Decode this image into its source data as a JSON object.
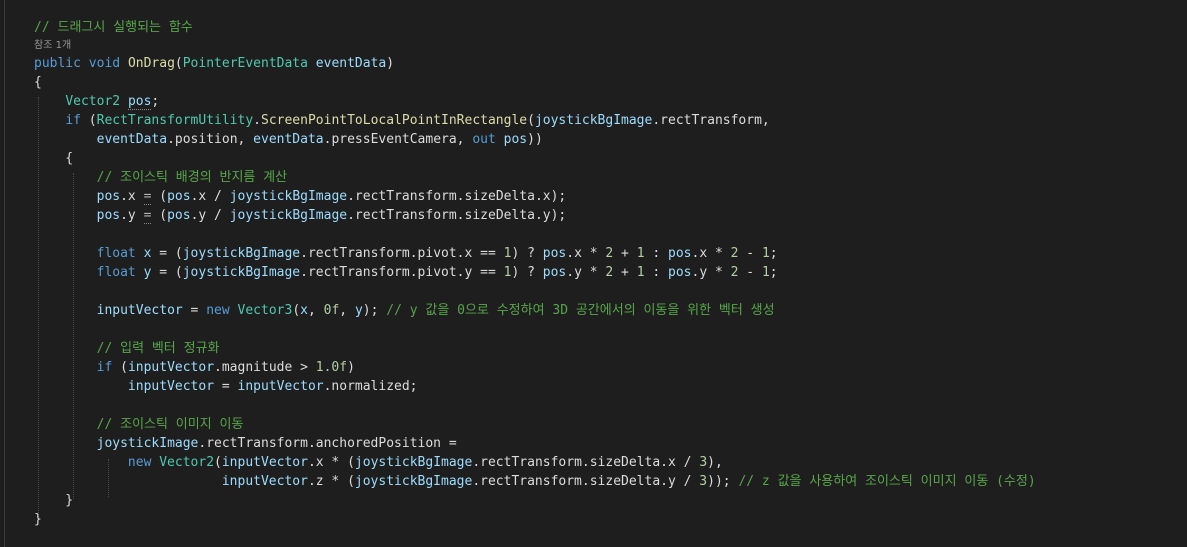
{
  "code_lens": "참조 1개",
  "lines": [
    {
      "t": [
        [
          "cmt",
          "// 드래그시 실행되는 함수"
        ]
      ]
    },
    {
      "t": [
        [
          "kw",
          "public"
        ],
        [
          "pl",
          " "
        ],
        [
          "kw",
          "void"
        ],
        [
          "pl",
          " "
        ],
        [
          "fn",
          "OnDrag"
        ],
        [
          "pl",
          "("
        ],
        [
          "ty",
          "PointerEventData"
        ],
        [
          "pl",
          " "
        ],
        [
          "var",
          "eventData"
        ],
        [
          "pl",
          ")"
        ]
      ]
    },
    {
      "t": [
        [
          "pl",
          "{"
        ]
      ]
    },
    {
      "t": [
        [
          "pl",
          "    "
        ],
        [
          "ty",
          "Vector2"
        ],
        [
          "pl",
          " "
        ],
        [
          "var",
          "pos"
        ],
        [
          "pl",
          ";"
        ]
      ]
    },
    {
      "t": [
        [
          "pl",
          "    "
        ],
        [
          "kw",
          "if"
        ],
        [
          "pl",
          " ("
        ],
        [
          "ty",
          "RectTransformUtility"
        ],
        [
          "pl",
          "."
        ],
        [
          "fn",
          "ScreenPointToLocalPointInRectangle"
        ],
        [
          "pl",
          "("
        ],
        [
          "var",
          "joystickBgImage"
        ],
        [
          "pl",
          ".rectTransform,"
        ]
      ]
    },
    {
      "t": [
        [
          "pl",
          "        "
        ],
        [
          "var",
          "eventData"
        ],
        [
          "pl",
          ".position, "
        ],
        [
          "var",
          "eventData"
        ],
        [
          "pl",
          ".pressEventCamera, "
        ],
        [
          "kw",
          "out"
        ],
        [
          "pl",
          " "
        ],
        [
          "var",
          "pos"
        ],
        [
          "pl",
          "))"
        ]
      ]
    },
    {
      "t": [
        [
          "pl",
          "    {"
        ]
      ]
    },
    {
      "t": [
        [
          "pl",
          "        "
        ],
        [
          "cmt",
          "// 조이스틱 배경의 반지름 계산"
        ]
      ]
    },
    {
      "t": [
        [
          "pl",
          "        "
        ],
        [
          "var",
          "pos"
        ],
        [
          "pl",
          ".x "
        ],
        [
          "op",
          "="
        ],
        [
          "pl",
          " ("
        ],
        [
          "var",
          "pos"
        ],
        [
          "pl",
          ".x / "
        ],
        [
          "var",
          "joystickBgImage"
        ],
        [
          "pl",
          ".rectTransform.sizeDelta.x);"
        ]
      ]
    },
    {
      "t": [
        [
          "pl",
          "        "
        ],
        [
          "var",
          "pos"
        ],
        [
          "pl",
          ".y "
        ],
        [
          "op",
          "="
        ],
        [
          "pl",
          " ("
        ],
        [
          "var",
          "pos"
        ],
        [
          "pl",
          ".y / "
        ],
        [
          "var",
          "joystickBgImage"
        ],
        [
          "pl",
          ".rectTransform.sizeDelta.y);"
        ]
      ]
    },
    {
      "t": [
        [
          "pl",
          ""
        ]
      ]
    },
    {
      "t": [
        [
          "pl",
          "        "
        ],
        [
          "kw",
          "float"
        ],
        [
          "pl",
          " "
        ],
        [
          "var",
          "x"
        ],
        [
          "pl",
          " = ("
        ],
        [
          "var",
          "joystickBgImage"
        ],
        [
          "pl",
          ".rectTransform.pivot.x == "
        ],
        [
          "num",
          "1"
        ],
        [
          "pl",
          ") ? "
        ],
        [
          "var",
          "pos"
        ],
        [
          "pl",
          ".x * "
        ],
        [
          "num",
          "2"
        ],
        [
          "pl",
          " + "
        ],
        [
          "num",
          "1"
        ],
        [
          "pl",
          " : "
        ],
        [
          "var",
          "pos"
        ],
        [
          "pl",
          ".x * "
        ],
        [
          "num",
          "2"
        ],
        [
          "pl",
          " - "
        ],
        [
          "num",
          "1"
        ],
        [
          "pl",
          ";"
        ]
      ]
    },
    {
      "t": [
        [
          "pl",
          "        "
        ],
        [
          "kw",
          "float"
        ],
        [
          "pl",
          " "
        ],
        [
          "var",
          "y"
        ],
        [
          "pl",
          " = ("
        ],
        [
          "var",
          "joystickBgImage"
        ],
        [
          "pl",
          ".rectTransform.pivot.y == "
        ],
        [
          "num",
          "1"
        ],
        [
          "pl",
          ") ? "
        ],
        [
          "var",
          "pos"
        ],
        [
          "pl",
          ".y * "
        ],
        [
          "num",
          "2"
        ],
        [
          "pl",
          " + "
        ],
        [
          "num",
          "1"
        ],
        [
          "pl",
          " : "
        ],
        [
          "var",
          "pos"
        ],
        [
          "pl",
          ".y * "
        ],
        [
          "num",
          "2"
        ],
        [
          "pl",
          " - "
        ],
        [
          "num",
          "1"
        ],
        [
          "pl",
          ";"
        ]
      ]
    },
    {
      "t": [
        [
          "pl",
          ""
        ]
      ]
    },
    {
      "t": [
        [
          "pl",
          "        "
        ],
        [
          "var",
          "inputVector"
        ],
        [
          "pl",
          " = "
        ],
        [
          "kw",
          "new"
        ],
        [
          "pl",
          " "
        ],
        [
          "ty",
          "Vector3"
        ],
        [
          "pl",
          "("
        ],
        [
          "var",
          "x"
        ],
        [
          "pl",
          ", "
        ],
        [
          "num",
          "0f"
        ],
        [
          "pl",
          ", "
        ],
        [
          "var",
          "y"
        ],
        [
          "pl",
          "); "
        ],
        [
          "cmt",
          "// y 값을 0으로 수정하여 3D 공간에서의 이동을 위한 벡터 생성"
        ]
      ]
    },
    {
      "t": [
        [
          "pl",
          ""
        ]
      ]
    },
    {
      "t": [
        [
          "pl",
          "        "
        ],
        [
          "cmt",
          "// 입력 벡터 정규화"
        ]
      ]
    },
    {
      "t": [
        [
          "pl",
          "        "
        ],
        [
          "kw",
          "if"
        ],
        [
          "pl",
          " ("
        ],
        [
          "var",
          "inputVector"
        ],
        [
          "pl",
          ".magnitude > "
        ],
        [
          "num",
          "1.0f"
        ],
        [
          "pl",
          ")"
        ]
      ]
    },
    {
      "t": [
        [
          "pl",
          "            "
        ],
        [
          "var",
          "inputVector"
        ],
        [
          "pl",
          " = "
        ],
        [
          "var",
          "inputVector"
        ],
        [
          "pl",
          ".normalized;"
        ]
      ]
    },
    {
      "t": [
        [
          "pl",
          ""
        ]
      ]
    },
    {
      "t": [
        [
          "pl",
          "        "
        ],
        [
          "cmt",
          "// 조이스틱 이미지 이동"
        ]
      ]
    },
    {
      "t": [
        [
          "pl",
          "        "
        ],
        [
          "var",
          "joystickImage"
        ],
        [
          "pl",
          ".rectTransform.anchoredPosition ="
        ]
      ]
    },
    {
      "t": [
        [
          "pl",
          "            "
        ],
        [
          "kw",
          "new"
        ],
        [
          "pl",
          " "
        ],
        [
          "ty",
          "Vector2"
        ],
        [
          "pl",
          "("
        ],
        [
          "var",
          "inputVector"
        ],
        [
          "pl",
          ".x * ("
        ],
        [
          "var",
          "joystickBgImage"
        ],
        [
          "pl",
          ".rectTransform.sizeDelta.x / "
        ],
        [
          "num",
          "3"
        ],
        [
          "pl",
          "),"
        ]
      ]
    },
    {
      "t": [
        [
          "pl",
          "                        "
        ],
        [
          "var",
          "inputVector"
        ],
        [
          "pl",
          ".z * ("
        ],
        [
          "var",
          "joystickBgImage"
        ],
        [
          "pl",
          ".rectTransform.sizeDelta.y / "
        ],
        [
          "num",
          "3"
        ],
        [
          "pl",
          "));"
        ],
        [
          "pl",
          " "
        ],
        [
          "cmt",
          "// z 값을 사용하여 조이스틱 이미지 이동 (수정)"
        ]
      ]
    },
    {
      "t": [
        [
          "pl",
          "    }"
        ]
      ]
    },
    {
      "t": [
        [
          "pl",
          "}"
        ]
      ]
    }
  ]
}
